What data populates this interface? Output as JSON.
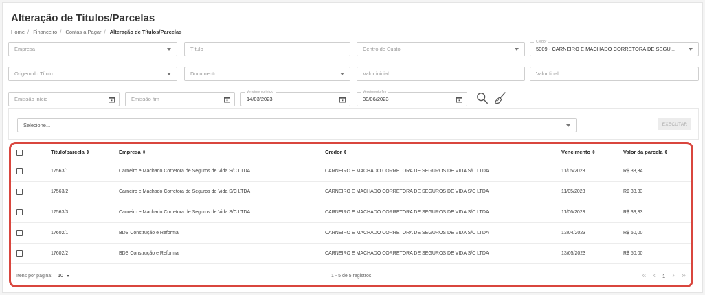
{
  "page": {
    "title": "Alteração de Títulos/Parcelas",
    "breadcrumb": [
      "Home",
      "Financeiro",
      "Contas a Pagar",
      "Alteração de Títulos/Parcelas"
    ]
  },
  "filters": {
    "empresa": "Empresa",
    "titulo": "Título",
    "centro_custo": "Centro de Custo",
    "credor_label": "Credor",
    "credor_value": "5009 - CARNEIRO E MACHADO CORRETORA DE SEGU...",
    "origem": "Origem do Título",
    "documento": "Documento",
    "valor_inicial": "Valor inicial",
    "valor_final": "Valor final",
    "emissao_inicio": "Emissão início",
    "emissao_fim": "Emissão fim",
    "vencimento_inicio_label": "Vencimento início",
    "vencimento_inicio": "14/03/2023",
    "vencimento_fim_label": "Vencimento fim",
    "vencimento_fim": "30/06/2023"
  },
  "actions": {
    "select_placeholder": "Selecione...",
    "execute_label": "EXECUTAR"
  },
  "table": {
    "headers": {
      "titulo": "Título/parcela",
      "empresa": "Empresa",
      "credor": "Credor",
      "vencimento": "Vencimento",
      "valor": "Valor da parcela"
    },
    "sort_icon": "⇕",
    "rows": [
      {
        "titulo": "17563/1",
        "empresa": "Carneiro e Machado Corretora de Seguros de Vida S/C LTDA",
        "credor": "CARNEIRO E MACHADO CORRETORA DE SEGUROS DE VIDA S/C LTDA",
        "vencimento": "11/05/2023",
        "valor": "R$ 33,34"
      },
      {
        "titulo": "17563/2",
        "empresa": "Carneiro e Machado Corretora de Seguros de Vida S/C LTDA",
        "credor": "CARNEIRO E MACHADO CORRETORA DE SEGUROS DE VIDA S/C LTDA",
        "vencimento": "11/05/2023",
        "valor": "R$ 33,33"
      },
      {
        "titulo": "17563/3",
        "empresa": "Carneiro e Machado Corretora de Seguros de Vida S/C LTDA",
        "credor": "CARNEIRO E MACHADO CORRETORA DE SEGUROS DE VIDA S/C LTDA",
        "vencimento": "11/06/2023",
        "valor": "R$ 33,33"
      },
      {
        "titulo": "17602/1",
        "empresa": "BDS Construção e Reforma",
        "credor": "CARNEIRO E MACHADO CORRETORA DE SEGUROS DE VIDA S/C LTDA",
        "vencimento": "13/04/2023",
        "valor": "R$ 50,00"
      },
      {
        "titulo": "17602/2",
        "empresa": "BDS Construção e Reforma",
        "credor": "CARNEIRO E MACHADO CORRETORA DE SEGUROS DE VIDA S/C LTDA",
        "vencimento": "13/05/2023",
        "valor": "R$ 50,00"
      }
    ]
  },
  "pagination": {
    "items_per_page_label": "Itens por página:",
    "items_per_page": "10",
    "range": "1 - 5 de 5 registros",
    "current_page": "1",
    "first": "«",
    "prev": "‹",
    "next": "›",
    "last": "»"
  },
  "colors": {
    "highlight": "#d9463e",
    "accent_icon": "#555555"
  }
}
